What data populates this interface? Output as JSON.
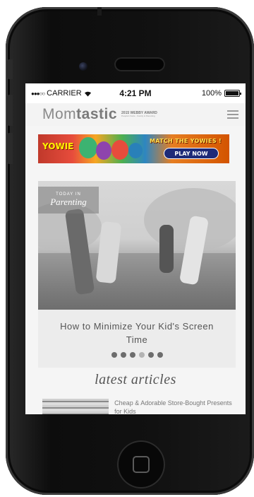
{
  "status_bar": {
    "signal": "●●●○○",
    "carrier": "CARRIER",
    "wifi_icon": "wifi-icon",
    "time": "4:21 PM",
    "battery": "100%"
  },
  "navbar": {
    "logo_light": "Mom",
    "logo_bold": "tastic",
    "award_line1": "2015 WEBBY AWARD",
    "award_line2": "People's Voice · Family & Parenting",
    "menu_icon": "hamburger-menu-icon"
  },
  "ad": {
    "brand": "YOWIE",
    "headline": "MATCH THE YOWIES !",
    "cta": "PLAY NOW"
  },
  "hero": {
    "tag_small": "TODAY IN",
    "tag_large": "Parenting",
    "title": "How to Minimize Your Kid's Screen Time",
    "dots_total": 6,
    "active_dots": [
      1,
      2,
      3,
      5,
      6
    ]
  },
  "latest": {
    "heading": "latest articles",
    "articles": [
      {
        "title": "Cheap & Adorable Store-Bought Presents for Kids"
      }
    ]
  },
  "colors": {
    "phone_body": "#111111",
    "screen_bg": "#f5f5f5",
    "caption_bg": "#ececec",
    "dot_active": "#6d6d6d",
    "dot_inactive": "#b3b3b3"
  }
}
